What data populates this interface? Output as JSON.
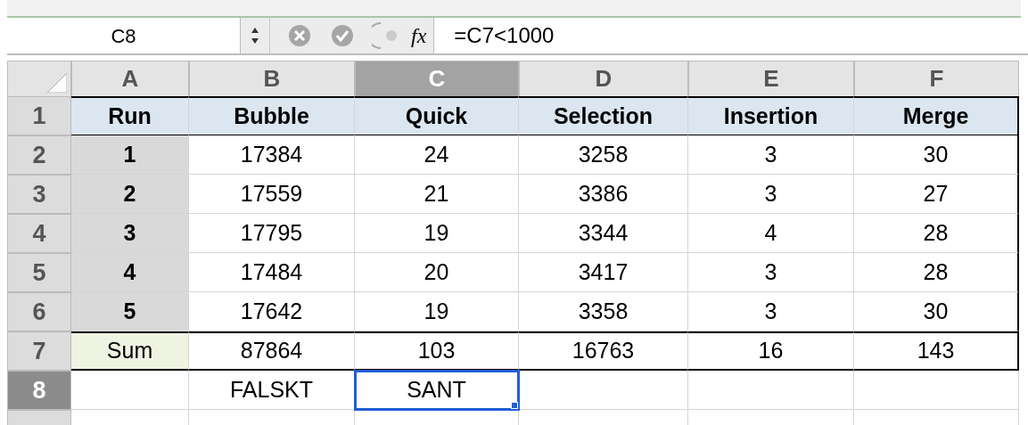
{
  "formula_bar": {
    "name_box": "C8",
    "function_label": "fx",
    "formula": "=C7<1000"
  },
  "column_headers": [
    {
      "label": "A",
      "selected": false
    },
    {
      "label": "B",
      "selected": false
    },
    {
      "label": "C",
      "selected": true
    },
    {
      "label": "D",
      "selected": false
    },
    {
      "label": "E",
      "selected": false
    },
    {
      "label": "F",
      "selected": false
    }
  ],
  "rows": [
    {
      "number": "1",
      "selected": false,
      "cells": [
        {
          "text": "Run",
          "kind": "header",
          "selected": false
        },
        {
          "text": "Bubble",
          "kind": "header",
          "selected": false
        },
        {
          "text": "Quick",
          "kind": "header",
          "selected": false
        },
        {
          "text": "Selection",
          "kind": "header",
          "selected": false
        },
        {
          "text": "Insertion",
          "kind": "header",
          "selected": false
        },
        {
          "text": "Merge",
          "kind": "header",
          "selected": false
        }
      ]
    },
    {
      "number": "2",
      "selected": false,
      "cells": [
        {
          "text": "1",
          "kind": "index",
          "selected": false
        },
        {
          "text": "17384",
          "kind": "value",
          "selected": false
        },
        {
          "text": "24",
          "kind": "value",
          "selected": false
        },
        {
          "text": "3258",
          "kind": "value",
          "selected": false
        },
        {
          "text": "3",
          "kind": "value",
          "selected": false
        },
        {
          "text": "30",
          "kind": "value",
          "selected": false
        }
      ]
    },
    {
      "number": "3",
      "selected": false,
      "cells": [
        {
          "text": "2",
          "kind": "index",
          "selected": false
        },
        {
          "text": "17559",
          "kind": "value",
          "selected": false
        },
        {
          "text": "21",
          "kind": "value",
          "selected": false
        },
        {
          "text": "3386",
          "kind": "value",
          "selected": false
        },
        {
          "text": "3",
          "kind": "value",
          "selected": false
        },
        {
          "text": "27",
          "kind": "value",
          "selected": false
        }
      ]
    },
    {
      "number": "4",
      "selected": false,
      "cells": [
        {
          "text": "3",
          "kind": "index",
          "selected": false
        },
        {
          "text": "17795",
          "kind": "value",
          "selected": false
        },
        {
          "text": "19",
          "kind": "value",
          "selected": false
        },
        {
          "text": "3344",
          "kind": "value",
          "selected": false
        },
        {
          "text": "4",
          "kind": "value",
          "selected": false
        },
        {
          "text": "28",
          "kind": "value",
          "selected": false
        }
      ]
    },
    {
      "number": "5",
      "selected": false,
      "cells": [
        {
          "text": "4",
          "kind": "index",
          "selected": false
        },
        {
          "text": "17484",
          "kind": "value",
          "selected": false
        },
        {
          "text": "20",
          "kind": "value",
          "selected": false
        },
        {
          "text": "3417",
          "kind": "value",
          "selected": false
        },
        {
          "text": "3",
          "kind": "value",
          "selected": false
        },
        {
          "text": "28",
          "kind": "value",
          "selected": false
        }
      ]
    },
    {
      "number": "6",
      "selected": false,
      "cells": [
        {
          "text": "5",
          "kind": "index",
          "selected": false
        },
        {
          "text": "17642",
          "kind": "value",
          "selected": false
        },
        {
          "text": "19",
          "kind": "value",
          "selected": false
        },
        {
          "text": "3358",
          "kind": "value",
          "selected": false
        },
        {
          "text": "3",
          "kind": "value",
          "selected": false
        },
        {
          "text": "30",
          "kind": "value",
          "selected": false
        }
      ]
    },
    {
      "number": "7",
      "selected": false,
      "cells": [
        {
          "text": "Sum",
          "kind": "sum_label",
          "selected": false
        },
        {
          "text": "87864",
          "kind": "sum",
          "selected": false
        },
        {
          "text": "103",
          "kind": "sum",
          "selected": false
        },
        {
          "text": "16763",
          "kind": "sum",
          "selected": false
        },
        {
          "text": "16",
          "kind": "sum",
          "selected": false
        },
        {
          "text": "143",
          "kind": "sum",
          "selected": false
        }
      ]
    },
    {
      "number": "8",
      "selected": true,
      "cells": [
        {
          "kind": "empty",
          "selected": false
        },
        {
          "text": "FALSKT",
          "kind": "value",
          "selected": false
        },
        {
          "text": "SANT",
          "kind": "value",
          "selected": true
        },
        {
          "kind": "empty",
          "selected": false
        },
        {
          "kind": "empty",
          "selected": false
        },
        {
          "kind": "empty",
          "selected": false
        }
      ]
    }
  ]
}
